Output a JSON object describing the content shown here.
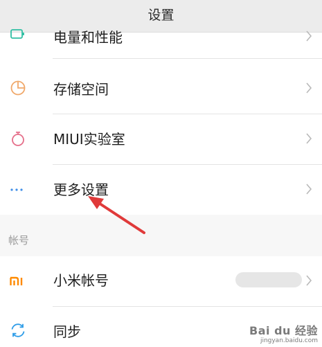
{
  "header": {
    "title": "设置"
  },
  "rows": {
    "battery": {
      "label": "电量和性能",
      "icon": "battery-icon"
    },
    "storage": {
      "label": "存储空间",
      "icon": "pie-chart-icon"
    },
    "lab": {
      "label": "MIUI实验室",
      "icon": "flask-icon"
    },
    "more": {
      "label": "更多设置",
      "icon": "more-dots-icon"
    }
  },
  "account_section": {
    "label": "帐号",
    "rows": {
      "mi_account": {
        "label": "小米帐号",
        "icon": "mi-logo-icon"
      },
      "sync": {
        "label": "同步",
        "icon": "sync-icon"
      }
    }
  },
  "watermark": {
    "brand": "Bai du 经验",
    "url": "jingyan.baidu.com"
  },
  "colors": {
    "battery": "#2fbfa3",
    "storage": "#f0a86a",
    "lab": "#e56f8a",
    "more": "#3f8ee8",
    "mi": "#ff8a00",
    "sync": "#2f9de8",
    "annotation_arrow": "#e03a3a"
  }
}
